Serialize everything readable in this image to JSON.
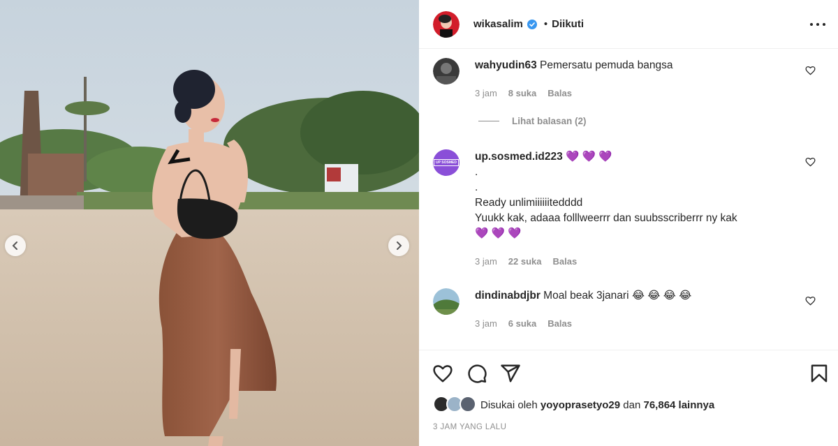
{
  "post": {
    "author": "wikasalim",
    "follow_separator": "•",
    "follow_status": "Diikuti",
    "liked_by_prefix": "Disukai oleh",
    "liked_by_user": "yoyoprasetyo29",
    "liked_by_joiner": "dan",
    "liked_by_count": "76,864 lainnya",
    "timestamp": "3 JAM YANG LALU"
  },
  "comments": [
    {
      "user": "wahyudin63",
      "text": "Pemersatu pemuda bangsa",
      "time": "3 jam",
      "likes": "8 suka",
      "reply": "Balas",
      "view_replies": "Lihat balasan (2)"
    },
    {
      "user": "up.sosmed.id223",
      "user_suffix": "💜 💜 💜",
      "lines": [
        ".",
        ".",
        "Ready unlimiiiiiitedddd",
        "Yuukk kak, adaaa folllweerrr dan suubsscriberrr ny kak"
      ],
      "hearts": "💜 💜 💜",
      "time": "3 jam",
      "likes": "22 suka",
      "reply": "Balas",
      "avatar_text": "UP SOSMED"
    },
    {
      "user": "dindinabdjbr",
      "text": "Moal beak 3janari 😂 😂 😂 😂",
      "time": "3 jam",
      "likes": "6 suka",
      "reply": "Balas"
    }
  ],
  "icons": {
    "like": "heart-icon",
    "comment": "comment-icon",
    "share": "share-icon",
    "save": "bookmark-icon",
    "prev": "chevron-left-icon",
    "next": "chevron-right-icon",
    "more": "more-options-icon"
  },
  "colors": {
    "verified": "#3897f0",
    "text": "#262626",
    "muted": "#8e8e8e",
    "purple": "#8a4fd8"
  }
}
